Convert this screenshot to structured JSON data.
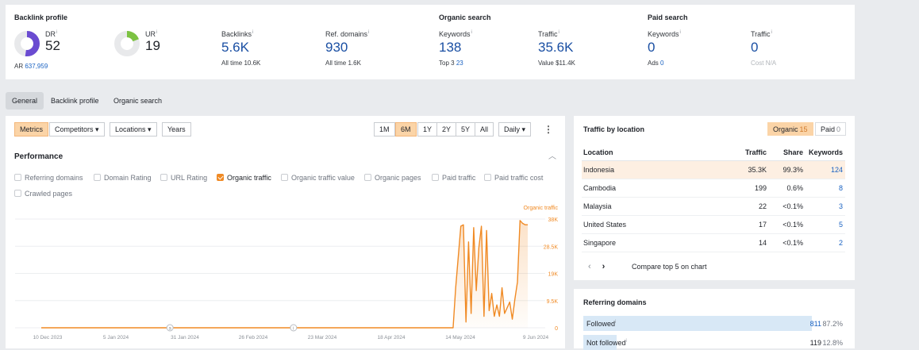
{
  "summary": {
    "backlink_profile": {
      "title": "Backlink profile",
      "dr": {
        "label": "DR",
        "info": "i",
        "value": "52",
        "level": 52,
        "color": "#6a4bd1"
      },
      "ur": {
        "label": "UR",
        "info": "i",
        "value": "19",
        "level": 19,
        "color": "#7cc242"
      },
      "ar": {
        "label": "AR",
        "value": "637,959"
      },
      "backlinks": {
        "label": "Backlinks",
        "info": "i",
        "value": "5.6K",
        "sub_label": "All time",
        "sub_value": "10.6K"
      },
      "ref_domains": {
        "label": "Ref. domains",
        "info": "i",
        "value": "930",
        "sub_label": "All time",
        "sub_value": "1.6K"
      }
    },
    "organic_search": {
      "title": "Organic search",
      "keywords": {
        "label": "Keywords",
        "info": "i",
        "value": "138",
        "sub_label": "Top 3",
        "sub_value": "23"
      },
      "traffic": {
        "label": "Traffic",
        "info": "i",
        "value": "35.6K",
        "sub_label": "Value",
        "sub_value": "$11.4K"
      }
    },
    "paid_search": {
      "title": "Paid search",
      "keywords": {
        "label": "Keywords",
        "info": "i",
        "value": "0",
        "sub_label": "Ads",
        "sub_value": "0"
      },
      "traffic": {
        "label": "Traffic",
        "info": "i",
        "value": "0",
        "sub_label": "Cost",
        "sub_value": "N/A"
      }
    }
  },
  "nav_tabs": [
    "General",
    "Backlink profile",
    "Organic search"
  ],
  "toolbar": {
    "metrics": "Metrics",
    "competitors": "Competitors",
    "locations": "Locations",
    "years": "Years",
    "ranges": [
      "1M",
      "6M",
      "1Y",
      "2Y",
      "5Y",
      "All"
    ],
    "active_range": "6M",
    "interval": "Daily",
    "dropdown_glyph": "▾",
    "more_glyph": "⋮"
  },
  "performance": {
    "title": "Performance",
    "collapse_glyph": "︿",
    "checkboxes": [
      {
        "label": "Referring domains",
        "checked": false
      },
      {
        "label": "Domain Rating",
        "checked": false
      },
      {
        "label": "URL Rating",
        "checked": false
      },
      {
        "label": "Organic traffic",
        "checked": true
      },
      {
        "label": "Organic traffic value",
        "checked": false
      },
      {
        "label": "Organic pages",
        "checked": false
      },
      {
        "label": "Paid traffic",
        "checked": false
      },
      {
        "label": "Paid traffic cost",
        "checked": false
      },
      {
        "label": "Crawled pages",
        "checked": false
      }
    ]
  },
  "chart_data": {
    "type": "line",
    "series": [
      {
        "name": "Organic traffic",
        "color": "#f08a24"
      }
    ],
    "x_tick_labels": [
      "10 Dec 2023",
      "5 Jan 2024",
      "31 Jan 2024",
      "26 Feb 2024",
      "23 Mar 2024",
      "18 Apr 2024",
      "14 May 2024",
      "9 Jun 2024"
    ],
    "y_tick_labels": [
      "38K",
      "28.5K",
      "19K",
      "9.5K",
      "0"
    ],
    "ylim": [
      0,
      38000
    ],
    "grid": true,
    "annotations": [
      {
        "x": 50,
        "label": "a"
      },
      {
        "x": 98,
        "label": "i"
      }
    ],
    "x": [
      0,
      160,
      161,
      163,
      164,
      165,
      166,
      167,
      168,
      169,
      170,
      171,
      172,
      173,
      174,
      175,
      176,
      177,
      178,
      179,
      180,
      181,
      182,
      183,
      184,
      185,
      186,
      187,
      188,
      189
    ],
    "values": [
      0,
      0,
      14000,
      35500,
      36000,
      2000,
      30000,
      5000,
      35000,
      13000,
      28000,
      35500,
      4000,
      34000,
      6000,
      12000,
      4000,
      8000,
      4000,
      14000,
      5000,
      7000,
      9000,
      3000,
      10000,
      16000,
      37500,
      36500,
      36000,
      36000
    ]
  },
  "traffic_by_location": {
    "title": "Traffic by location",
    "toggle": [
      {
        "label": "Organic",
        "count": "15",
        "active": true
      },
      {
        "label": "Paid",
        "count": "0",
        "active": false
      }
    ],
    "columns": [
      "Location",
      "Traffic",
      "Share",
      "Keywords"
    ],
    "rows": [
      {
        "location": "Indonesia",
        "traffic": "35.3K",
        "share": "99.3%",
        "keywords": "124"
      },
      {
        "location": "Cambodia",
        "traffic": "199",
        "share": "0.6%",
        "keywords": "8"
      },
      {
        "location": "Malaysia",
        "traffic": "22",
        "share": "<0.1%",
        "keywords": "3"
      },
      {
        "location": "United States",
        "traffic": "17",
        "share": "<0.1%",
        "keywords": "5"
      },
      {
        "location": "Singapore",
        "traffic": "14",
        "share": "<0.1%",
        "keywords": "2"
      }
    ],
    "prev_glyph": "‹",
    "next_glyph": "›",
    "compare": "Compare top 5 on chart"
  },
  "referring_domains": {
    "title": "Referring domains",
    "rows": [
      {
        "label": "Followed",
        "info": "i",
        "value": "811",
        "pct": "87.2%",
        "share": 0.872
      },
      {
        "label": "Not followed",
        "info": "i",
        "value": "119",
        "pct": "12.8%",
        "share": 0.128
      }
    ]
  }
}
